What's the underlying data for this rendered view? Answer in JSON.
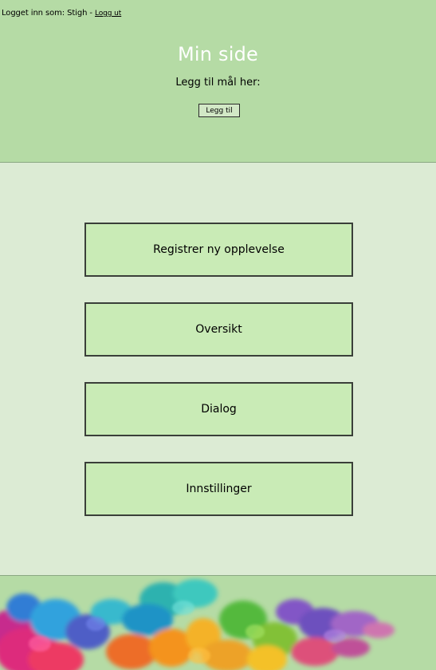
{
  "header": {
    "login_text": "Logget inn som: Stigh - ",
    "logout_label": "Logg ut",
    "title": "Min side",
    "goal_prompt": "Legg til mål her:",
    "add_goal_label": "Legg til"
  },
  "nav": [
    {
      "label": "Registrer ny opplevelse"
    },
    {
      "label": "Oversikt"
    },
    {
      "label": "Dialog"
    },
    {
      "label": "Innstillinger"
    }
  ],
  "colors": {
    "header_bg": "#b5dba5",
    "main_bg": "#dcebd4",
    "button_bg": "#c9ebb6"
  }
}
